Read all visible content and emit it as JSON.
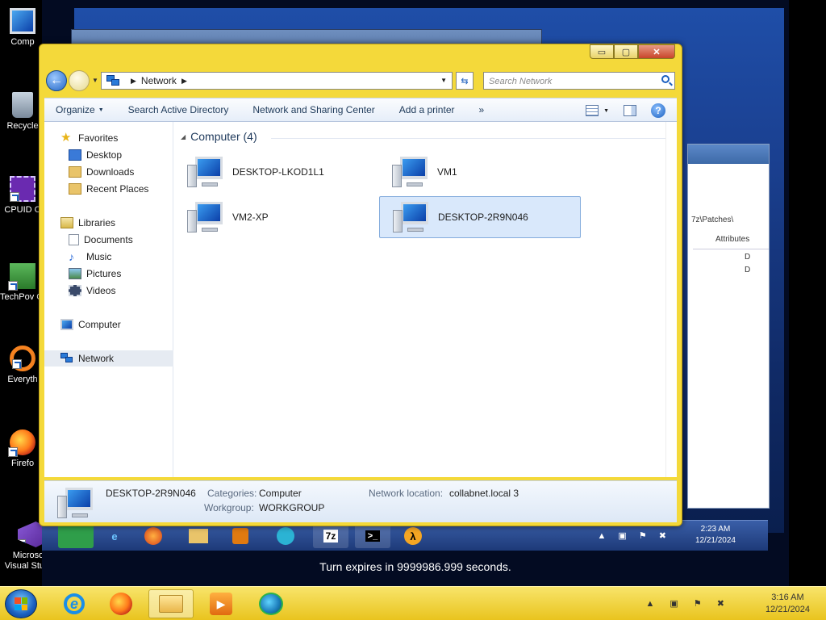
{
  "host_desktop": {
    "icons": [
      {
        "name": "computer",
        "label": "Comp"
      },
      {
        "name": "recycle-bin",
        "label": "Recycle"
      },
      {
        "name": "cpuid",
        "label": "CPUID C"
      },
      {
        "name": "techpowerup-gpuz",
        "label": "TechPov GPU-"
      },
      {
        "name": "everything",
        "label": "Everyth"
      },
      {
        "name": "firefox",
        "label": "Firefo"
      },
      {
        "name": "visual-studio",
        "label": "Microsoft Visual Stud..."
      }
    ]
  },
  "vm": {
    "background_window_path": "7z\\Patches\\",
    "background_window_col": "Attributes",
    "background_window_rows": [
      "D",
      "D"
    ],
    "taskbar_buttons": [
      "7z",
      ">_",
      "λ"
    ],
    "clock_time": "2:23 AM",
    "clock_date": "12/21/2024",
    "turn_text": "Turn expires in 9999986.999 seconds."
  },
  "explorer": {
    "window_controls": {
      "minimize": "▭",
      "maximize": "▢",
      "close": "✕"
    },
    "address": {
      "breadcrumb": "Network"
    },
    "search": {
      "placeholder": "Search Network"
    },
    "commands": [
      {
        "label": "Organize",
        "has_dropdown": true
      },
      {
        "label": "Search Active Directory"
      },
      {
        "label": "Network and Sharing Center"
      },
      {
        "label": "Add a printer"
      },
      {
        "label": "»"
      }
    ],
    "nav_pane": {
      "favorites": {
        "label": "Favorites",
        "items": [
          "Desktop",
          "Downloads",
          "Recent Places"
        ]
      },
      "libraries": {
        "label": "Libraries",
        "items": [
          "Documents",
          "Music",
          "Pictures",
          "Videos"
        ]
      },
      "computer": "Computer",
      "network": "Network"
    },
    "group": {
      "label": "Computer (4)"
    },
    "items": [
      {
        "name": "DESKTOP-LKOD1L1",
        "selected": false
      },
      {
        "name": "VM1",
        "selected": false
      },
      {
        "name": "VM2-XP",
        "selected": false
      },
      {
        "name": "DESKTOP-2R9N046",
        "selected": true
      }
    ],
    "details": {
      "name": "DESKTOP-2R9N046",
      "categories_label": "Categories:",
      "categories_value": "Computer",
      "workgroup_label": "Workgroup:",
      "workgroup_value": "WORKGROUP",
      "location_label": "Network location:",
      "location_value": "collabnet.local  3"
    }
  },
  "host_taskbar": {
    "apps": [
      "internet-explorer",
      "firefox",
      "file-explorer",
      "media-player",
      "remote-app"
    ],
    "clock_time": "3:16 AM",
    "clock_date": "12/21/2024"
  },
  "colors": {
    "window_frame": "#f4d93a",
    "accent": "#1c5fbf",
    "selection": "#d9e8fb"
  }
}
